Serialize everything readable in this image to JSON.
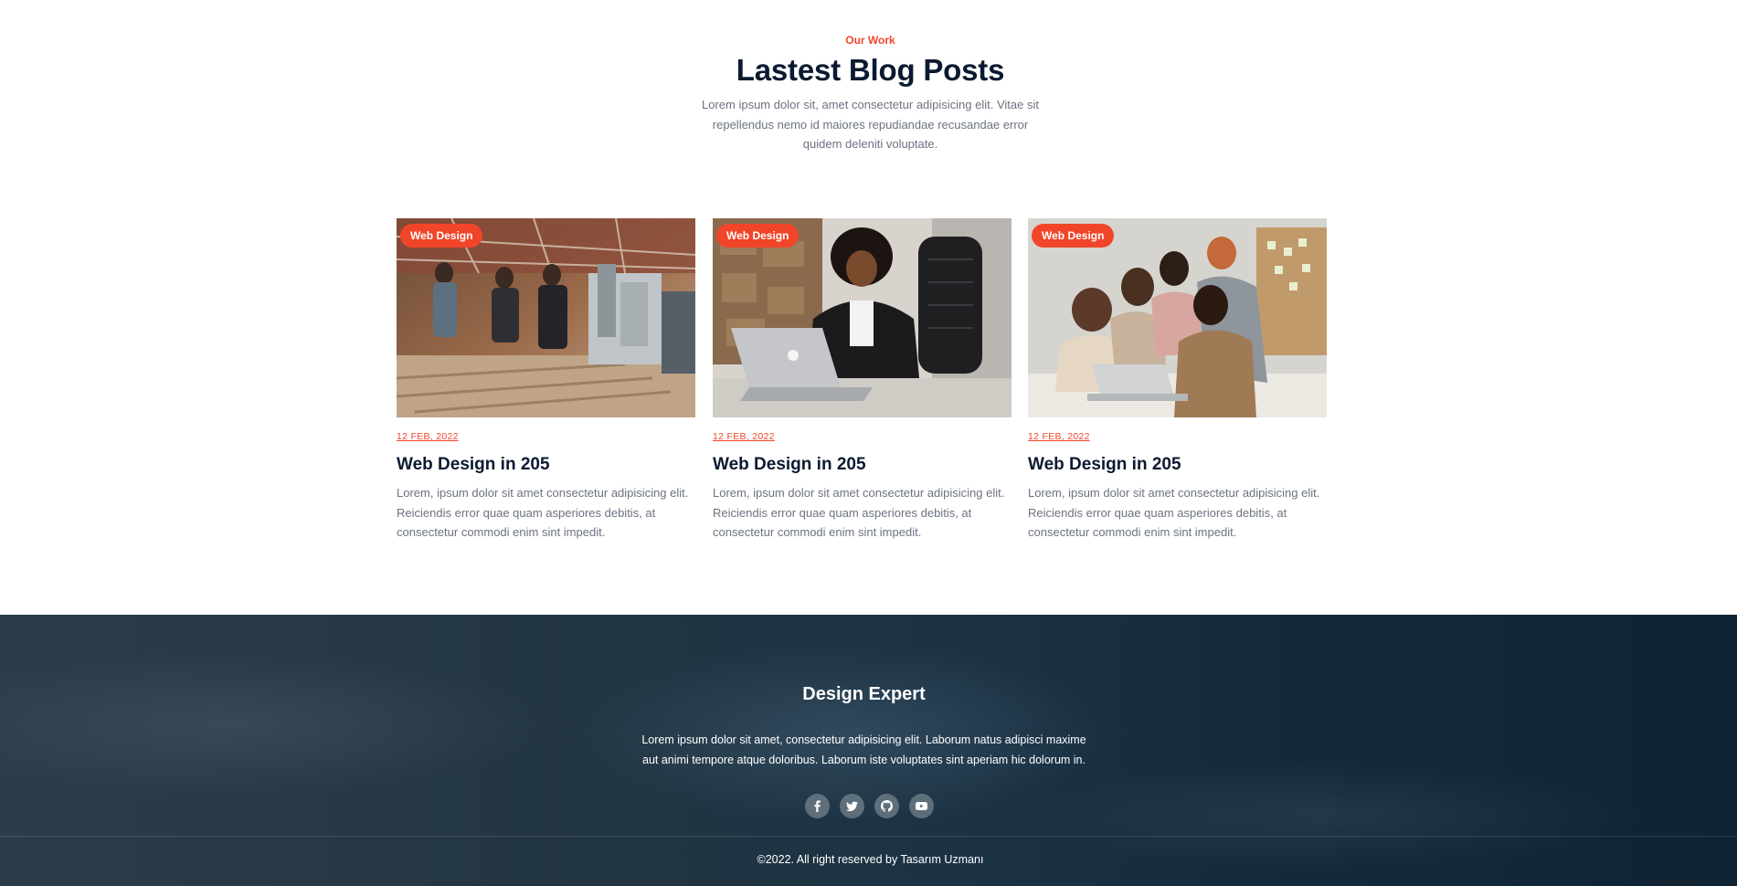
{
  "blog": {
    "eyebrow": "Our Work",
    "title": "Lastest Blog Posts",
    "description": "Lorem ipsum dolor sit, amet consectetur adipisicing elit. Vitae sit repellendus nemo id maiores repudiandae recusandae error quidem deleniti voluptate.",
    "posts": [
      {
        "tag": "Web Design",
        "date": "12 FEB, 2022",
        "title": "Web Design in 205",
        "excerpt": "Lorem, ipsum dolor sit amet consectetur adipisicing elit. Reiciendis error quae quam asperiores debitis, at consectetur commodi enim sint impedit.",
        "image": "workshop-team-photo"
      },
      {
        "tag": "Web Design",
        "date": "12 FEB, 2022",
        "title": "Web Design in 205",
        "excerpt": "Lorem, ipsum dolor sit amet consectetur adipisicing elit. Reiciendis error quae quam asperiores debitis, at consectetur commodi enim sint impedit.",
        "image": "woman-laptop-phone-photo"
      },
      {
        "tag": "Web Design",
        "date": "12 FEB, 2022",
        "title": "Web Design in 205",
        "excerpt": "Lorem, ipsum dolor sit amet consectetur adipisicing elit. Reiciendis error quae quam asperiores debitis, at consectetur commodi enim sint impedit.",
        "image": "team-around-laptop-photo"
      }
    ]
  },
  "footer": {
    "title": "Design Expert",
    "text": "Lorem ipsum dolor sit amet, consectetur adipisicing elit. Laborum natus adipisci maxime aut animi tempore atque doloribus. Laborum iste voluptates sint aperiam hic dolorum in.",
    "social": [
      "facebook-icon",
      "twitter-icon",
      "github-icon",
      "youtube-icon"
    ],
    "copyright": "©2022. All right reserved by Tasarım Uzmanı"
  },
  "colors": {
    "accent": "#f1452a",
    "heading": "#0b1a30",
    "body_text": "#6b7280",
    "footer_bg": "#1c3344"
  }
}
